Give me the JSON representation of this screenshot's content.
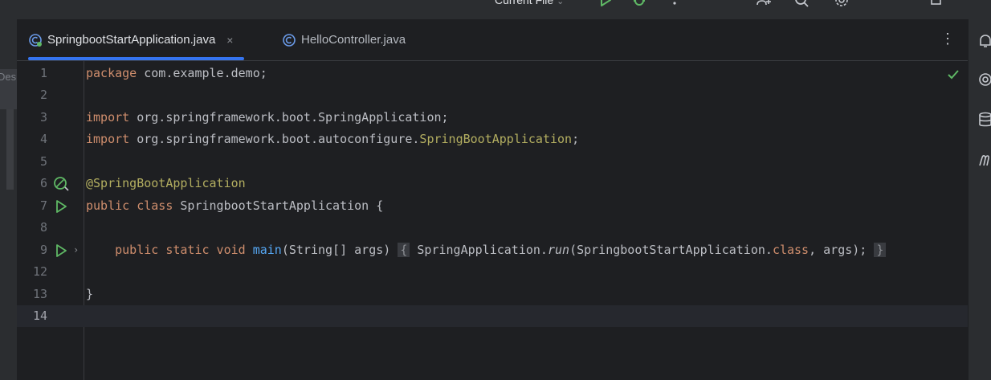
{
  "toolbar": {
    "run_config_label": "Current File",
    "run_config_chevron": "⌄",
    "icons": [
      "run-icon",
      "debug-icon",
      "more-vertical-icon",
      "add-user-icon",
      "search-icon",
      "settings-icon",
      "window-icon"
    ]
  },
  "left_panel": {
    "tab_label": "Des"
  },
  "tabs": [
    {
      "label": "SpringbootStartApplication.java",
      "active": true,
      "close": "×",
      "icon": "spring-class-file-icon"
    },
    {
      "label": "HelloController.java",
      "active": false,
      "icon": "java-class-file-icon"
    }
  ],
  "editor": {
    "lines": [
      {
        "num": "1"
      },
      {
        "num": "2"
      },
      {
        "num": "3"
      },
      {
        "num": "4"
      },
      {
        "num": "5"
      },
      {
        "num": "6"
      },
      {
        "num": "7"
      },
      {
        "num": "8"
      },
      {
        "num": "9"
      },
      {
        "num": "12"
      },
      {
        "num": "13"
      },
      {
        "num": "14"
      }
    ],
    "code": {
      "l1": {
        "kw": "package",
        "rest": " com.example.demo;"
      },
      "l3": {
        "kw": "import",
        "rest": " org.springframework.boot.SpringApplication;"
      },
      "l4": {
        "kw": "import",
        "rest": " org.springframework.boot.autoconfigure.",
        "ann": "SpringBootApplication",
        "end": ";"
      },
      "l6": {
        "ann": "@SpringBootApplication"
      },
      "l7": {
        "kw": "public class",
        "rest": " SpringbootStartApplication {"
      },
      "l9": {
        "indent": "    ",
        "kw": "public static void",
        "sp": " ",
        "fn": "main",
        "params": "(String[] args)",
        "fold_open": "{",
        "body1": " SpringApplication.",
        "it": "run",
        "body2": "(SpringbootStartApplication.",
        "kw2": "class",
        "body3": ", args); ",
        "fold_close": "}"
      },
      "l13": {
        "rest": "}"
      }
    },
    "gutter_fold_chevron": "›"
  },
  "colors": {
    "keyword": "#cf8e6d",
    "annotation": "#b3ae60",
    "function": "#56a8f5",
    "text": "#bcbec4",
    "accent": "#3574f0",
    "run_green": "#5fb865"
  }
}
